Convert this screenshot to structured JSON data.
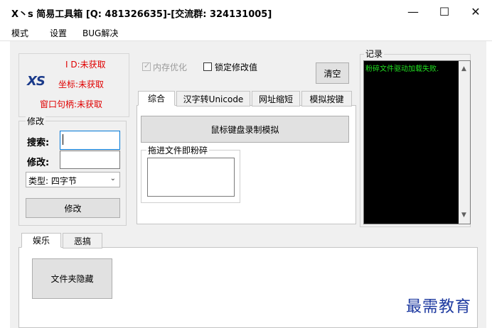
{
  "window": {
    "title": "X丶s 简易工具箱 [Q: 481326635]-[交流群: 324131005]",
    "minimize_glyph": "—",
    "maximize_glyph": "☐",
    "close_glyph": "✕"
  },
  "menu": {
    "items": [
      "模式",
      "设置",
      "BUG解决"
    ]
  },
  "info": {
    "logo": "XS",
    "id": "I D:未获取",
    "coords": "坐标:未获取",
    "handle": "窗口句柄:未获取"
  },
  "modify": {
    "group_title": "修改",
    "search_label": "搜索:",
    "search_value": "",
    "modify_label": "修改:",
    "modify_value": "",
    "type_value": "类型: 四字节",
    "button": "修改"
  },
  "options": {
    "memory_opt": "内存优化",
    "lock_value": "锁定修改值",
    "clear_button": "清空"
  },
  "tabs": [
    "综合",
    "汉字转Unicode",
    "网址缩短",
    "模拟按键"
  ],
  "general_tab": {
    "record_button": "鼠标键盘录制模拟",
    "shred_group": "拖进文件即粉碎"
  },
  "log": {
    "title": "记录",
    "lines": [
      "粉碎文件驱动加载失败."
    ]
  },
  "bottom_tabs": [
    "娱乐",
    "恶搞"
  ],
  "fun_tab": {
    "hide_folder_button": "文件夹隐藏"
  },
  "watermark": "最需教育"
}
